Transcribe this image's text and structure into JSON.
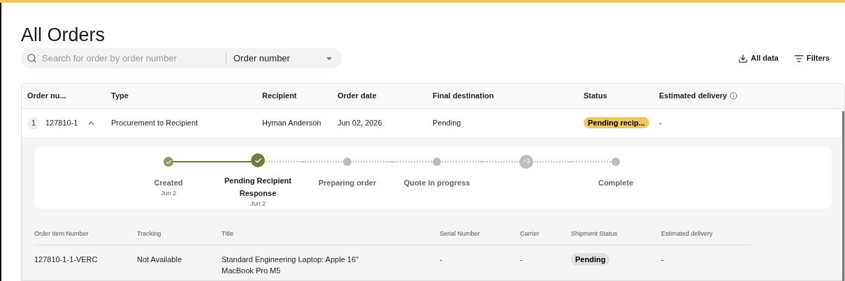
{
  "page": {
    "title": "All Orders"
  },
  "search": {
    "placeholder": "Search for order by order number",
    "field": "Order number"
  },
  "actions": [
    {
      "kind": "download",
      "label": "All data"
    },
    {
      "kind": "filter",
      "label": "Filters"
    }
  ],
  "table": {
    "columns": [
      "Order nu...",
      "Type",
      "Recipient",
      "Order date",
      "Final destination",
      "Status",
      "Estimated delivery"
    ],
    "rows": [
      {
        "count": "1",
        "order_number": "127810-1",
        "expanded": true,
        "type": "Procurement to Recipient",
        "recipient": "Hyman Anderson",
        "order_date": "Jun 02, 2026",
        "final_destination": "Pending",
        "status": "Pending recip...",
        "color": "#efc75e",
        "estimated_delivery": "-",
        "steps": [
          {
            "kind": "done",
            "label": "Created",
            "date": "Jun 2"
          },
          {
            "kind": "current",
            "label": "Pending Recipient Response",
            "date": "Jun 2"
          },
          {
            "kind": "pending",
            "label": "Preparing order"
          },
          {
            "kind": "pending",
            "label": "Quote in progress"
          },
          {
            "kind": "more",
            "count": "+3"
          },
          {
            "kind": "pending",
            "label": "Complete"
          }
        ],
        "items": {
          "columns": [
            "Order Item Number",
            "Tracking",
            "Title",
            "Serial Number",
            "Carrier",
            "Shipment Status",
            "Estimated delivery"
          ],
          "rows": [
            {
              "order_item_number": "127810-1-1-VERC",
              "tracking": "Not Available",
              "title": "Standard Engineering Laptop: Apple 16\" MacBook Pro M5",
              "serial_number": "-",
              "carrier": "-",
              "shipment_status": "Pending",
              "estimated_delivery": "-"
            }
          ]
        }
      }
    ]
  }
}
